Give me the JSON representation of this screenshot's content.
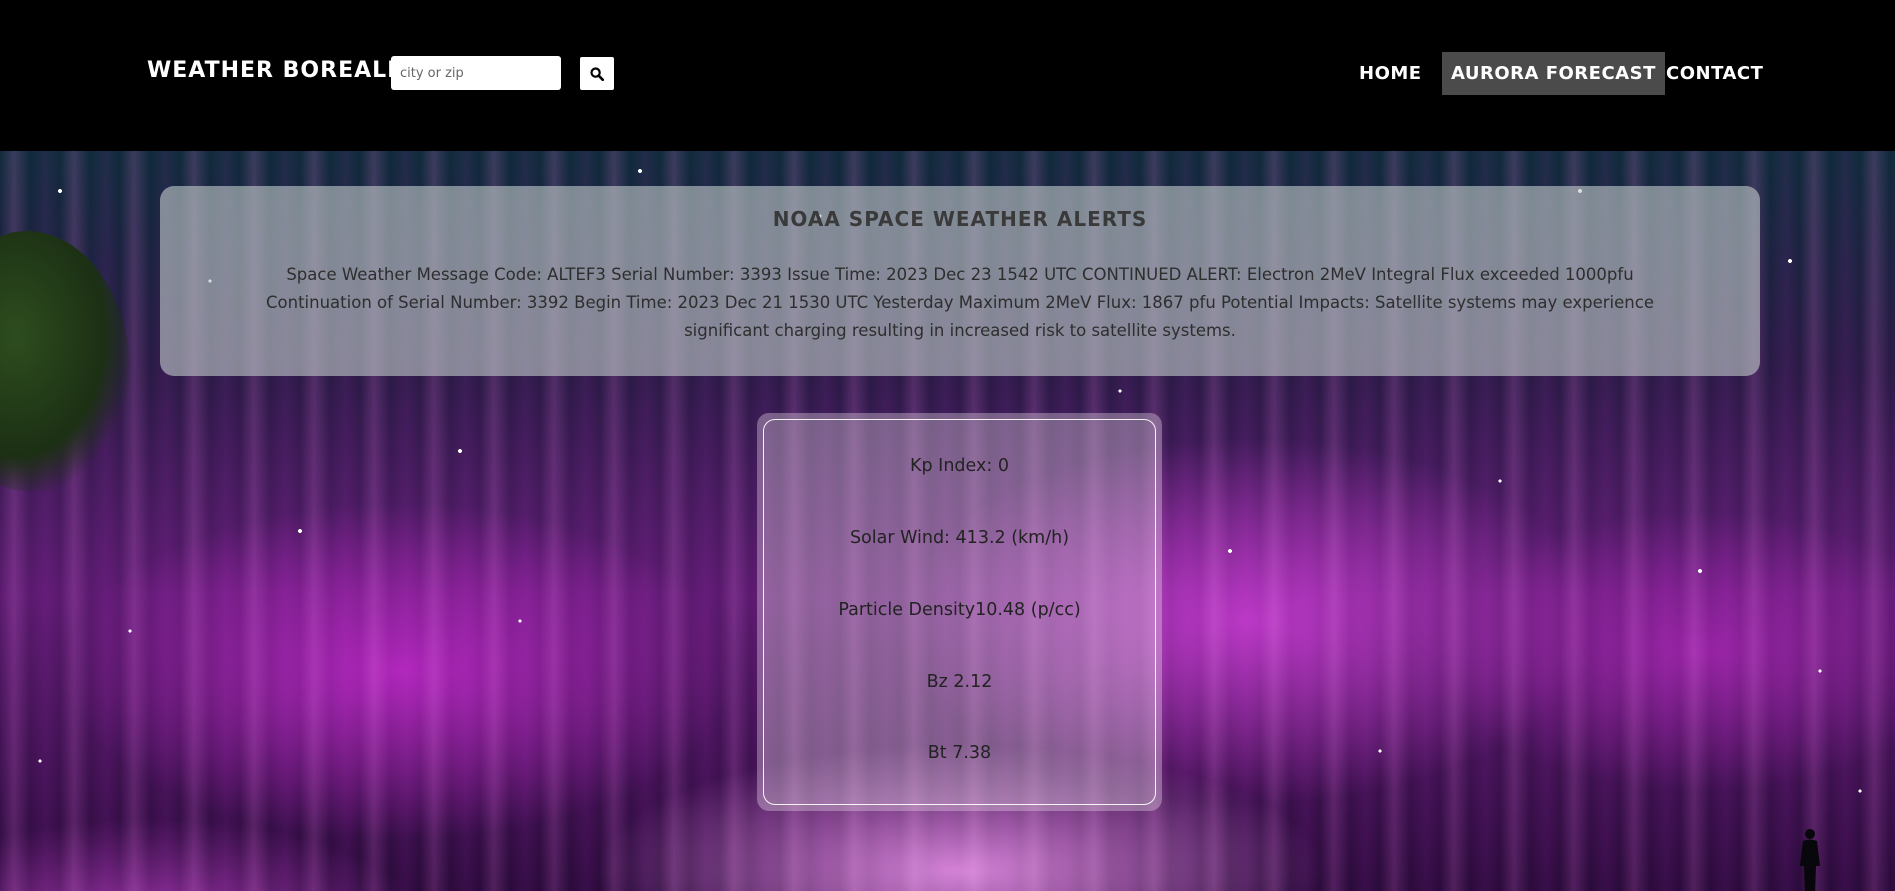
{
  "header": {
    "brand": "WEATHER BOREALIS",
    "search": {
      "placeholder": "city or zip",
      "value": "",
      "button_icon": "search-icon"
    },
    "nav": {
      "items": [
        {
          "label": "HOME",
          "active": false
        },
        {
          "label": "AURORA FORECAST",
          "active": true
        },
        {
          "label": "CONTACT",
          "active": false
        }
      ]
    }
  },
  "alerts": {
    "title": "NOAA SPACE WEATHER ALERTS",
    "message": "Space Weather Message Code: ALTEF3 Serial Number: 3393 Issue Time: 2023 Dec 23 1542 UTC CONTINUED ALERT: Electron 2MeV Integral Flux exceeded 1000pfu Continuation of Serial Number: 3392 Begin Time: 2023 Dec 21 1530 UTC Yesterday Maximum 2MeV Flux: 1867 pfu Potential Impacts: Satellite systems may experience significant charging resulting in increased risk to satellite systems."
  },
  "metrics": {
    "kp_index": "Kp Index: 0",
    "solar_wind": "Solar Wind: 413.2 (km/h)",
    "particle_density": "Particle Density10.48 (p/cc)",
    "bz": "Bz 2.12",
    "bt": "Bt 7.38"
  },
  "colors": {
    "header_background": "#000000",
    "active_nav_background": "#4b4b4b",
    "aurora_accent": "#d040e0"
  }
}
